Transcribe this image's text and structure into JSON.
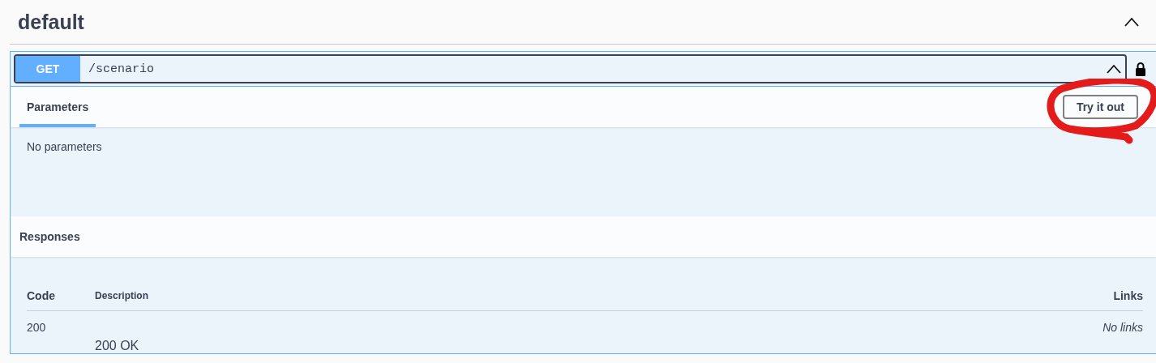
{
  "section": {
    "title": "default",
    "expanded": true
  },
  "operation": {
    "method": "GET",
    "path": "/scenario",
    "expanded": true,
    "locked": true
  },
  "tabs": [
    {
      "label": "Parameters",
      "selected": true
    }
  ],
  "try_it_out": {
    "label": "Try it out",
    "circled": true
  },
  "parameters": {
    "empty_text": "No parameters"
  },
  "responses": {
    "title": "Responses",
    "columns": [
      "Code",
      "Description",
      "Links"
    ],
    "rows": [
      {
        "code": "200",
        "description": "200 OK",
        "links": "No links"
      }
    ]
  }
}
